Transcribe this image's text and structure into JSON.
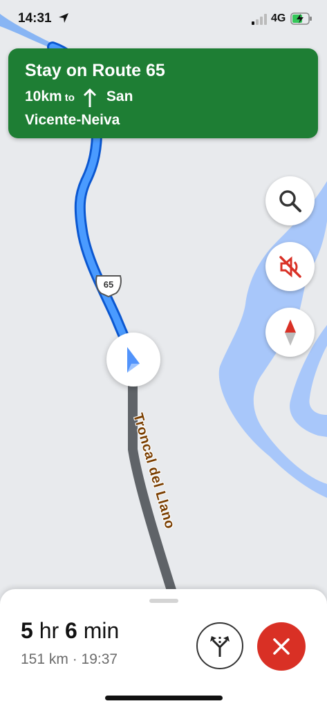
{
  "status_bar": {
    "time": "14:31",
    "network": "4G"
  },
  "banner": {
    "title": "Stay on Route 65",
    "distance": "10km",
    "to": "to",
    "destination_line1": "San",
    "destination_line2": "Vicente-Neiva",
    "color": "#1e7e34"
  },
  "map": {
    "route_shield": "65",
    "road_name": "Troncal del Llano"
  },
  "controls": {
    "search_icon": "search-icon",
    "mute_icon": "mute-icon",
    "compass_icon": "compass-icon"
  },
  "trip": {
    "eta_hours": "5",
    "eta_hours_unit": "hr",
    "eta_minutes": "6",
    "eta_minutes_unit": "min",
    "details": "151 km · 19:37"
  },
  "colors": {
    "route": "#1a73e8",
    "water": "#a8c7fa",
    "close": "#d93025"
  }
}
